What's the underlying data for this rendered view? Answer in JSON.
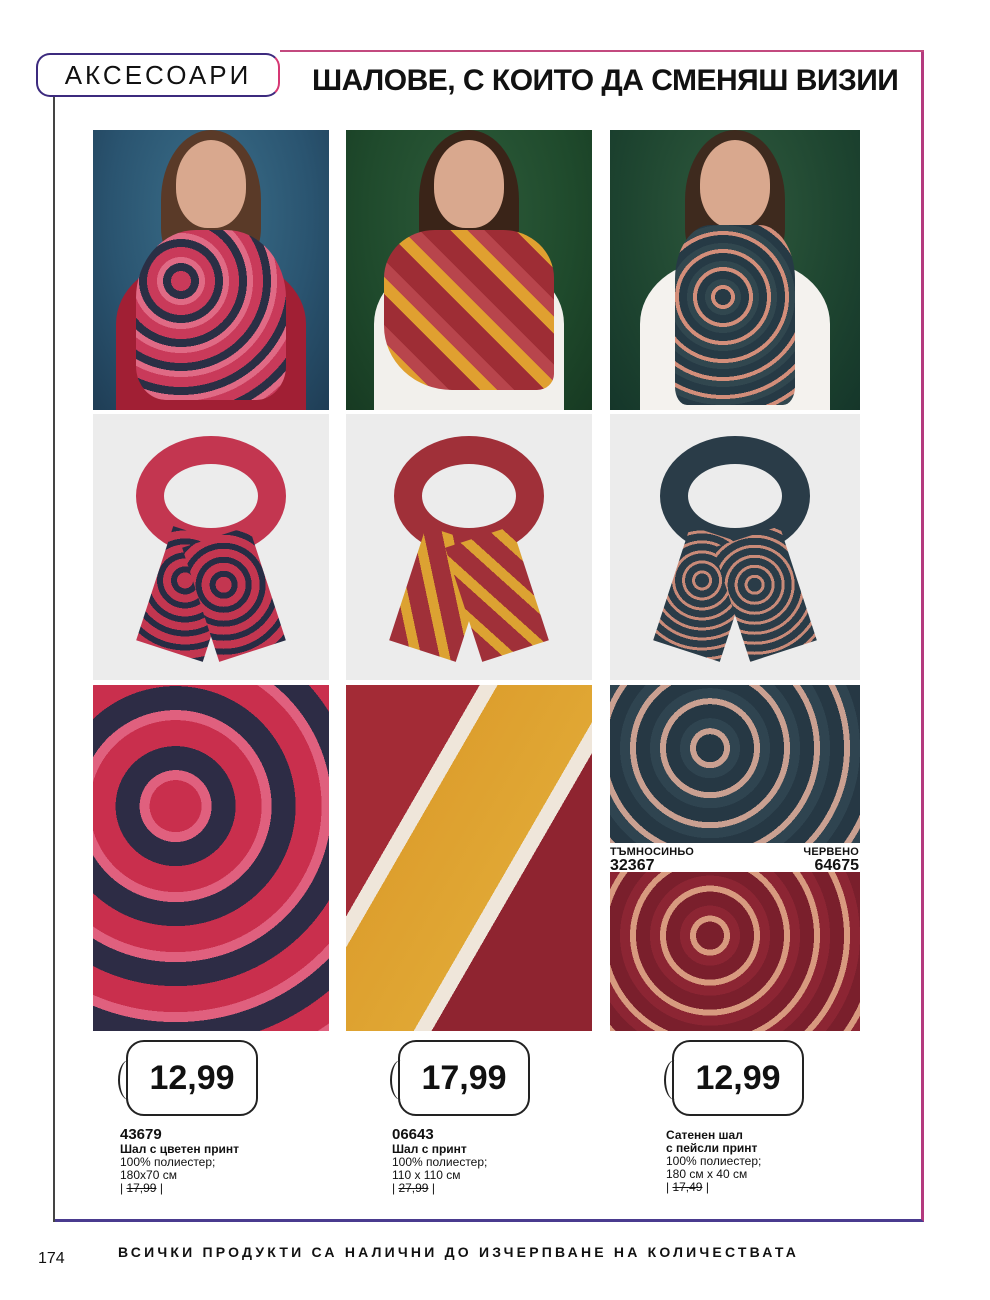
{
  "header": {
    "category": "АКСЕСОАРИ",
    "headline": "ШАЛОВЕ, С КОИТО ДА СМЕНЯШ ВИЗИИ"
  },
  "swatches": [
    {
      "name": "ТЪМНОСИНЬО",
      "code": "32367"
    },
    {
      "name": "ЧЕРВЕНО",
      "code": "64675"
    }
  ],
  "products": [
    {
      "price": "12,99",
      "code": "43679",
      "name": "Шал с цветен принт",
      "material": "100% полиестер;",
      "size": "180x70 см",
      "old_price": "17,99"
    },
    {
      "price": "17,99",
      "code": "06643",
      "name": "Шал с принт",
      "material": "100% полиестер;",
      "size": "110 x 110 см",
      "old_price": "27,99"
    },
    {
      "price": "12,99",
      "name_line1": "Сатенен шал",
      "name_line2": "с пейсли принт",
      "material": "100% полиестер;",
      "size": "180 см x 40 см",
      "old_price": "17,49"
    }
  ],
  "footer": {
    "page_number": "174",
    "notice": "ВСИЧКИ ПРОДУКТИ СА НАЛИЧНИ ДО ИЗЧЕРПВАНЕ НА КОЛИЧЕСТВАТА"
  }
}
